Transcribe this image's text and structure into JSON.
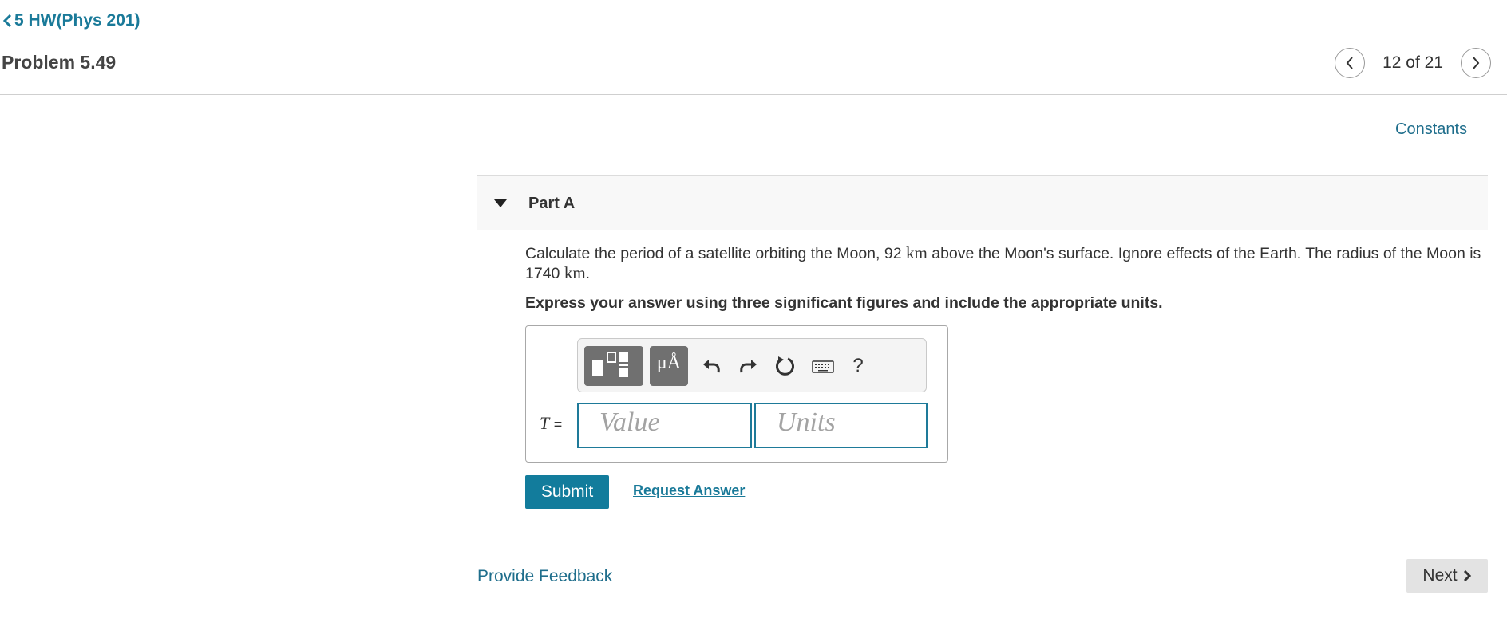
{
  "header": {
    "back_label": "5 HW(Phys 201)",
    "problem_title": "Problem 5.49",
    "pager_text": "12 of 21"
  },
  "main": {
    "constants_label": "Constants",
    "part_label": "Part A",
    "question": {
      "text_1": "Calculate the period of a satellite orbiting the Moon, 92 ",
      "unit_1": "km",
      "text_2": " above the Moon's surface. Ignore effects of the Earth. The radius of the Moon is 1740 ",
      "unit_2": "km",
      "text_3": "."
    },
    "instruction": "Express your answer using three significant figures and include the appropriate units.",
    "answer": {
      "variable": "T",
      "equals": "=",
      "value_placeholder": "Value",
      "units_placeholder": "Units"
    },
    "toolbar": {
      "buttons": [
        "templates-icon",
        "units-mu-angstrom-icon",
        "undo-icon",
        "redo-icon",
        "reset-icon",
        "keyboard-icon",
        "help-icon"
      ],
      "units_label": "μÅ",
      "help_label": "?"
    },
    "submit_label": "Submit",
    "request_answer_label": "Request Answer"
  },
  "footer": {
    "feedback_label": "Provide Feedback",
    "next_label": "Next"
  },
  "colors": {
    "link": "#1a7a99",
    "submit_bg": "#127c9c",
    "field_border": "#1e7a99",
    "toolbar_button": "#707070"
  }
}
